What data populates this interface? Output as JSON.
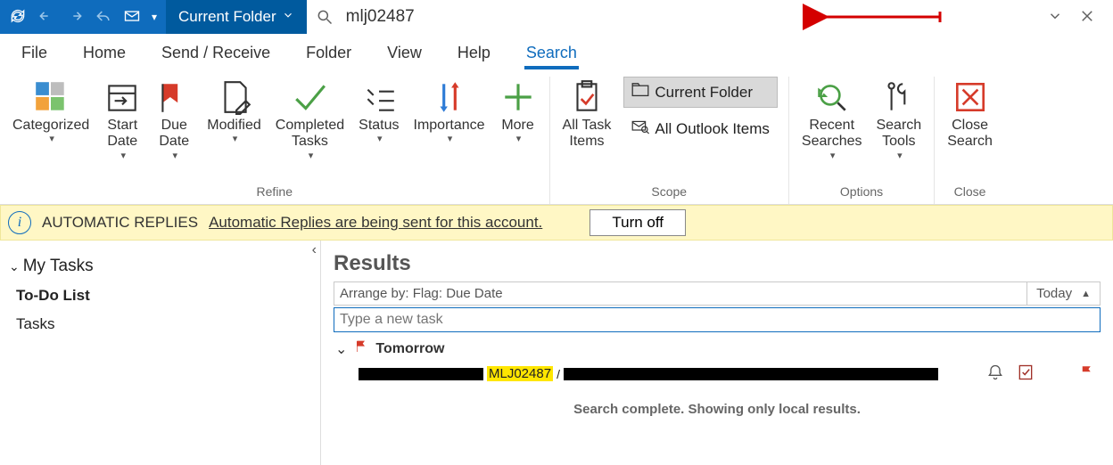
{
  "titlebar": {
    "scope_label": "Current Folder",
    "search_value": "mlj02487"
  },
  "tabs": [
    "File",
    "Home",
    "Send / Receive",
    "Folder",
    "View",
    "Help",
    "Search"
  ],
  "active_tab": "Search",
  "ribbon": {
    "refine": {
      "label": "Refine",
      "items": {
        "categorized": "Categorized",
        "start_date": "Start\nDate",
        "due_date": "Due\nDate",
        "modified": "Modified",
        "completed": "Completed\nTasks",
        "status": "Status",
        "importance": "Importance",
        "more": "More"
      }
    },
    "scope": {
      "label": "Scope",
      "all_task_items": "All Task\nItems",
      "current_folder": "Current Folder",
      "all_outlook": "All Outlook Items"
    },
    "options": {
      "label": "Options",
      "recent": "Recent\nSearches",
      "tools": "Search\nTools"
    },
    "close": {
      "label": "Close",
      "close_search": "Close\nSearch"
    }
  },
  "notice": {
    "title": "AUTOMATIC REPLIES",
    "link": "Automatic Replies are being sent for this account.",
    "button": "Turn off"
  },
  "nav": {
    "header": "My Tasks",
    "items": [
      "To-Do List",
      "Tasks"
    ],
    "selected": "To-Do List"
  },
  "content": {
    "results_title": "Results",
    "arrange_by": "Arrange by: Flag: Due Date",
    "arrange_right": "Today",
    "new_task_placeholder": "Type a new task",
    "group_label": "Tomorrow",
    "match_text": "MLJ02487",
    "match_sep": "/",
    "status": "Search complete. Showing only local results."
  }
}
